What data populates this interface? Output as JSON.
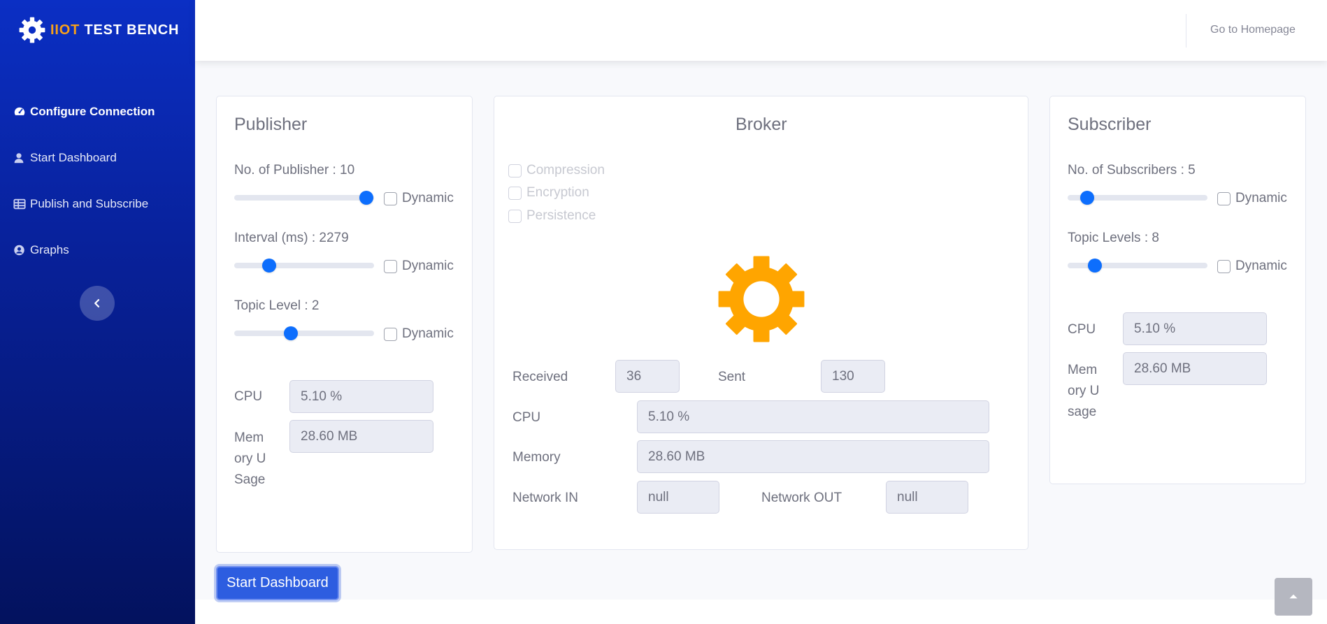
{
  "brand": {
    "prefix": "IIOT",
    "suffix": "TEST BENCH"
  },
  "sidebar": {
    "items": [
      {
        "label": "Configure Connection",
        "icon": "tachometer-icon",
        "active": true
      },
      {
        "label": "Start Dashboard",
        "icon": "user-icon"
      },
      {
        "label": "Publish and Subscribe",
        "icon": "table-icon"
      },
      {
        "label": "Graphs",
        "icon": "user-circle-icon"
      }
    ],
    "toggle_icon": "chevron-left-icon"
  },
  "topbar": {
    "home_link": "Go to Homepage"
  },
  "publisher": {
    "title": "Publisher",
    "count_label": "No. of Publisher : 10",
    "count_value": 10,
    "interval_label": "Interval (ms) : 2279",
    "interval_value": 2279,
    "topic_label": "Topic Level : 2",
    "topic_value": 2,
    "dynamic_label": "Dynamic",
    "cpu_label": "CPU",
    "cpu_value": "5.10 %",
    "memory_label": "Memory USage",
    "memory_value": "28.60 MB"
  },
  "broker": {
    "title": "Broker",
    "options": [
      "Compression",
      "Encryption",
      "Persistence"
    ],
    "received_label": "Received",
    "received_value": "36",
    "sent_label": "Sent",
    "sent_value": "130",
    "cpu_label": "CPU",
    "cpu_value": "5.10 %",
    "memory_label": "Memory",
    "memory_value": "28.60 MB",
    "net_in_label": "Network IN",
    "net_in_value": "null",
    "net_out_label": "Network OUT",
    "net_out_value": "null",
    "gear_color": "#ffa500"
  },
  "subscriber": {
    "title": "Subscriber",
    "count_label": "No. of Subscribers : 5",
    "count_value": 5,
    "topic_label": "Topic Levels : 8",
    "topic_value": 8,
    "dynamic_label": "Dynamic",
    "cpu_label": "CPU",
    "cpu_value": "5.10 %",
    "memory_label": "Memory Usage",
    "memory_value": "28.60 MB"
  },
  "actions": {
    "start_dashboard": "Start Dashboard"
  },
  "colors": {
    "sidebar_top": "#0b2fc4",
    "sidebar_bottom": "#03125e",
    "accent": "#f6a01a",
    "primary": "#2d5de0",
    "slider_thumb": "#0d6efd"
  }
}
